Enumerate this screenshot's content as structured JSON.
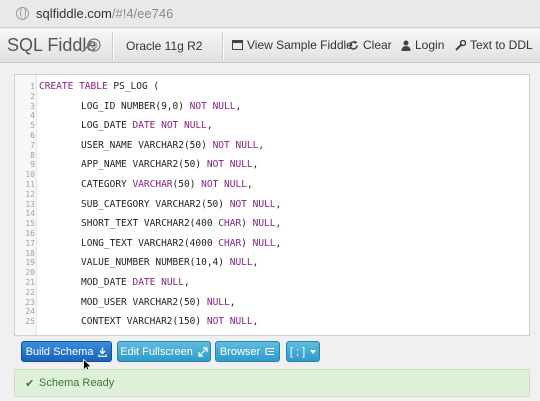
{
  "browser": {
    "url_host": "sqlfiddle.com",
    "url_rest": "/#!4/ee746"
  },
  "header": {
    "brand": "SQL Fiddle",
    "db_version": "Oracle 11g R2",
    "nav": {
      "view_sample": "View Sample Fiddle",
      "clear": "Clear",
      "login": "Login",
      "text_to_ddl": "Text to DDL"
    }
  },
  "schema_editor": {
    "lines": [
      {
        "n": "1",
        "text": "CREATE TABLE PS_LOG ("
      },
      {
        "n": "2",
        "text": ""
      },
      {
        "n": "3",
        "text": "LOG_ID NUMBER(9,0) NOT NULL,"
      },
      {
        "n": "4",
        "text": ""
      },
      {
        "n": "5",
        "text": "LOG_DATE DATE NOT NULL,"
      },
      {
        "n": "6",
        "text": ""
      },
      {
        "n": "7",
        "text": "USER_NAME VARCHAR2(50) NOT NULL,"
      },
      {
        "n": "8",
        "text": ""
      },
      {
        "n": "9",
        "text": "APP_NAME VARCHAR2(50) NOT NULL,"
      },
      {
        "n": "10",
        "text": ""
      },
      {
        "n": "11",
        "text": "CATEGORY VARCHAR(50) NOT NULL,"
      },
      {
        "n": "12",
        "text": ""
      },
      {
        "n": "13",
        "text": "SUB_CATEGORY VARCHAR2(50) NOT NULL,"
      },
      {
        "n": "14",
        "text": ""
      },
      {
        "n": "15",
        "text": "SHORT_TEXT VARCHAR2(400 CHAR) NULL,"
      },
      {
        "n": "16",
        "text": ""
      },
      {
        "n": "17",
        "text": "LONG_TEXT VARCHAR2(4000 CHAR) NULL,"
      },
      {
        "n": "18",
        "text": ""
      },
      {
        "n": "19",
        "text": "VALUE_NUMBER NUMBER(10,4) NULL,"
      },
      {
        "n": "20",
        "text": ""
      },
      {
        "n": "21",
        "text": "MOD_DATE DATE NULL,"
      },
      {
        "n": "22",
        "text": ""
      },
      {
        "n": "23",
        "text": "MOD_USER VARCHAR2(50) NULL,"
      },
      {
        "n": "24",
        "text": ""
      },
      {
        "n": "25",
        "text": "CONTEXT VARCHAR2(150) NOT NULL,"
      }
    ]
  },
  "toolbar": {
    "build_schema": "Build Schema",
    "edit_fullscreen": "Edit Fullscreen",
    "browser": "Browser",
    "terminator": "[ ; ]"
  },
  "status": {
    "message": "Schema Ready"
  },
  "colors": {
    "keyword": "#8a1e8a",
    "primary": "#1a63bb",
    "info": "#2f9bc9",
    "success_bg": "#dff0d8",
    "success_text": "#3c763d"
  }
}
